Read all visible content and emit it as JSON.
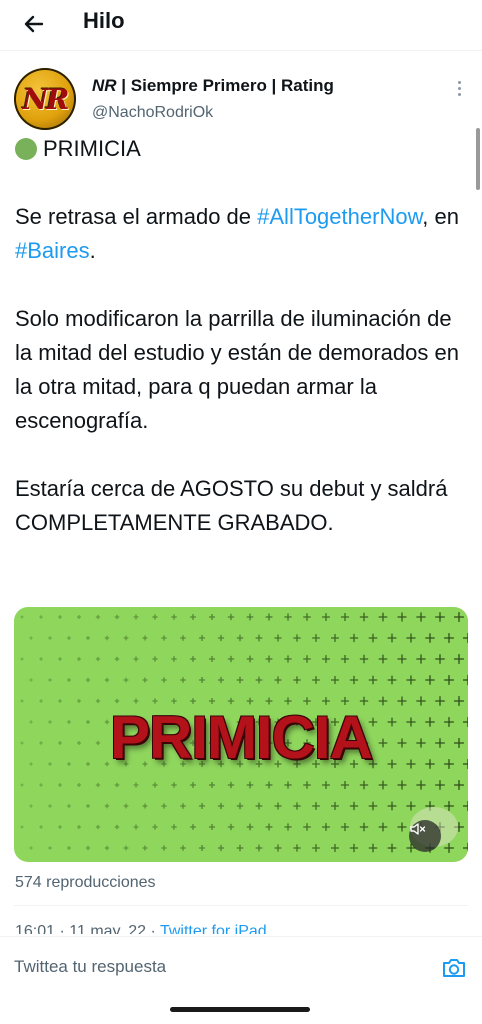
{
  "header": {
    "title": "Hilo",
    "back_icon": "arrow-left-icon"
  },
  "tweet": {
    "author": {
      "name_prefix": "NR",
      "name_rest": " | Siempre Primero | Rating",
      "handle": "@NachoRodriOk",
      "avatar_text": "NR"
    },
    "text": {
      "line1": "PRIMICIA",
      "p2_a": "Se retrasa el armado de ",
      "p2_link1": "#AllTogetherNow",
      "p2_b": ", en ",
      "p2_link2": "#Baires",
      "p2_c": ".",
      "p3": "Solo modificaron la parrilla de iluminación de la mitad del estudio y están de demorados en la otra mitad, para q puedan armar la escenografía.",
      "p4": "Estaría cerca de AGOSTO su debut y saldrá COMPLETAMENTE GRABADO."
    },
    "media": {
      "overlay_text": "PRIMICIA",
      "background_color": "#8fd65d",
      "text_color": "#b3121a"
    },
    "views": "574 reproducciones",
    "meta": {
      "time": "16:01 · 11 may. 22 · ",
      "source": "Twitter for iPad"
    }
  },
  "reply": {
    "placeholder": "Twittea tu respuesta",
    "camera_icon": "camera-icon"
  },
  "colors": {
    "link": "#1d9bf0",
    "muted": "#536471",
    "text": "#0f1419",
    "green_dot": "#78b159"
  }
}
